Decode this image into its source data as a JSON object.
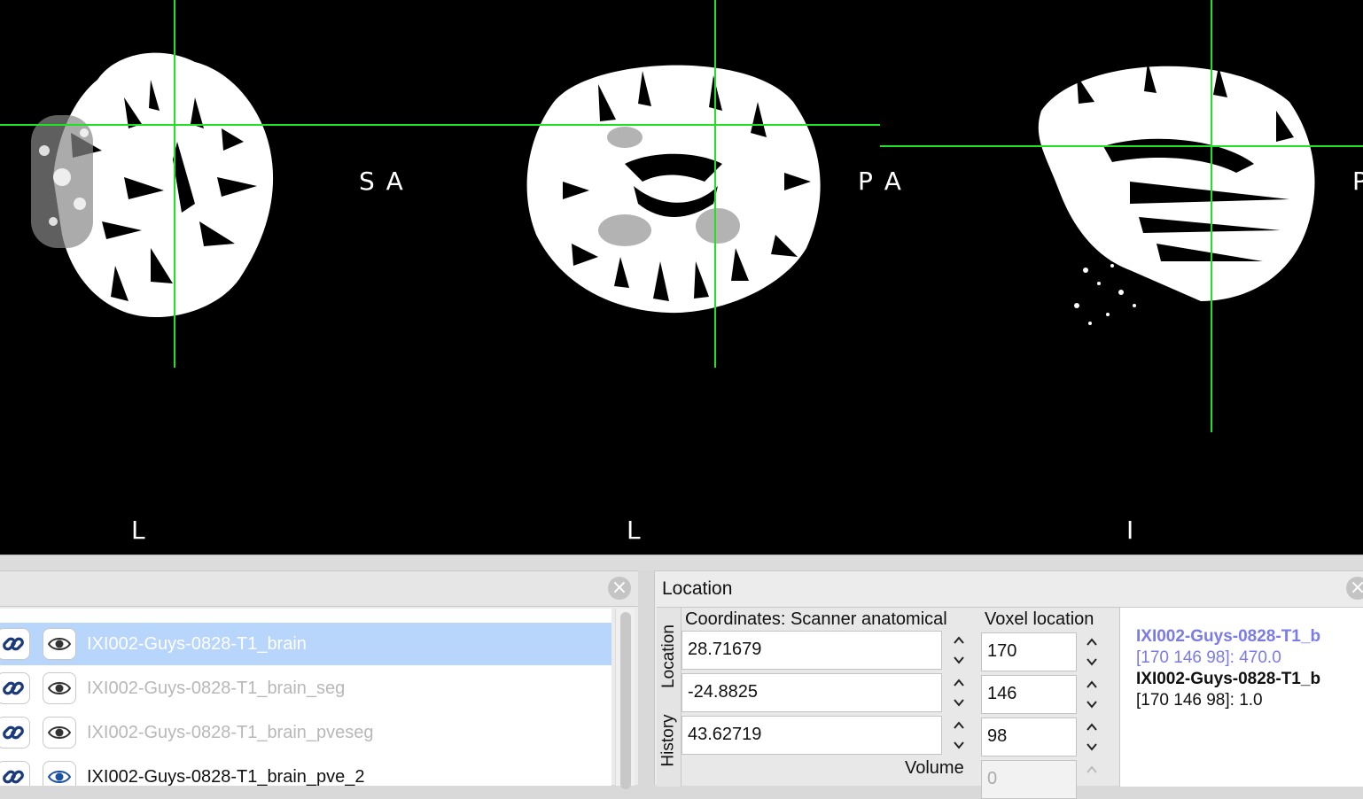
{
  "viewer": {
    "crosshair_color": "#22e024",
    "views": [
      {
        "name": "axial",
        "orient_right": "S A",
        "orient_bottom": "L"
      },
      {
        "name": "coronal",
        "orient_right": "P A",
        "orient_bottom": "L"
      },
      {
        "name": "sagittal",
        "orient_right": "P",
        "orient_bottom": "I"
      }
    ]
  },
  "overlay_list": {
    "items": [
      {
        "name": "IXI002-Guys-0828-T1_brain",
        "selected": true,
        "icons": [
          "link-icon",
          "eye-icon"
        ]
      },
      {
        "name": "IXI002-Guys-0828-T1_brain_seg",
        "selected": false,
        "icons": [
          "link-icon",
          "eye-icon"
        ]
      },
      {
        "name": "IXI002-Guys-0828-T1_brain_pveseg",
        "selected": false,
        "icons": [
          "link-icon",
          "eye-icon"
        ]
      },
      {
        "name": "IXI002-Guys-0828-T1_brain_pve_2",
        "selected": false,
        "icons": [
          "link-icon",
          "eye-icon"
        ]
      }
    ]
  },
  "location": {
    "title": "Location",
    "tabs": [
      "Location",
      "History"
    ],
    "coords_label": "Coordinates: Scanner anatomical",
    "voxel_label": "Voxel location",
    "volume_label": "Volume",
    "coords": [
      "28.71679",
      "-24.8825",
      "43.62719"
    ],
    "voxels": [
      "170",
      "146",
      "98"
    ],
    "volume": "0",
    "info": [
      {
        "text": "IXI002-Guys-0828-T1_b",
        "style": "name-selected",
        "color": "#7b7be8"
      },
      {
        "text": "[170 146 98]: 470.0",
        "style": "value-selected",
        "color": "#7b7be8"
      },
      {
        "text": "IXI002-Guys-0828-T1_b",
        "style": "name",
        "color": "#111111"
      },
      {
        "text": "[170 146 98]: 1.0",
        "style": "value",
        "color": "#111111"
      }
    ]
  }
}
